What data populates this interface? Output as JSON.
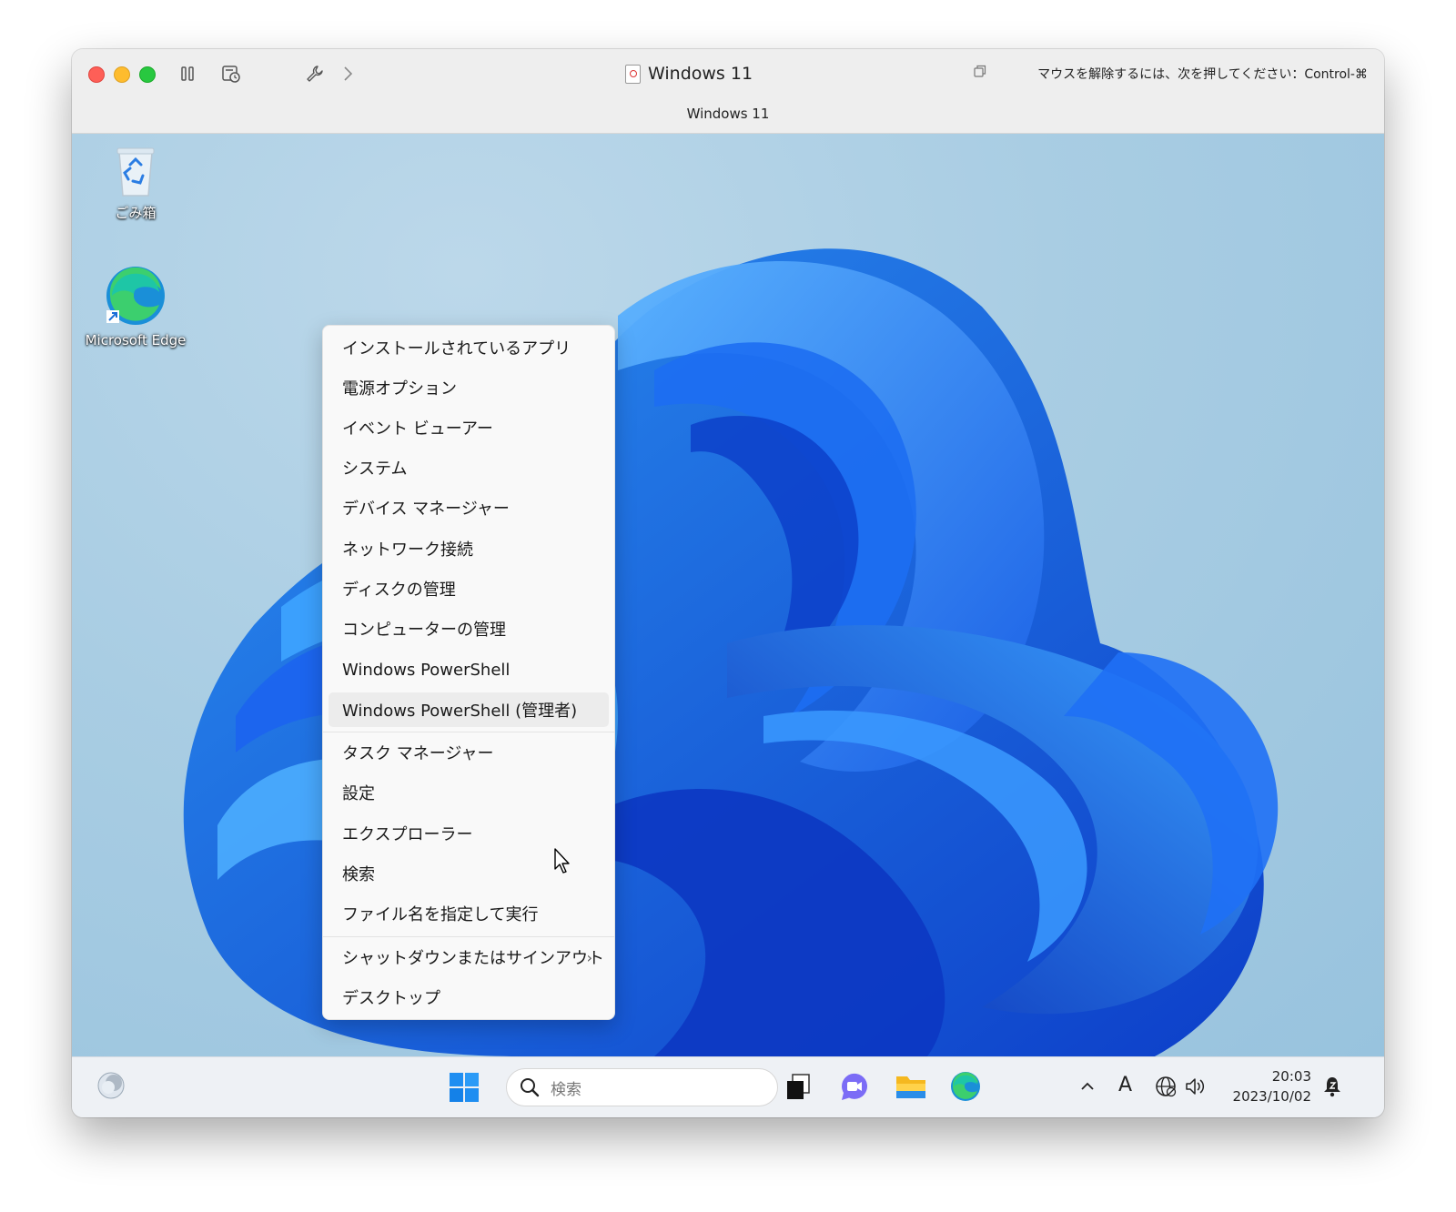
{
  "host_window": {
    "title": "Windows 11",
    "subtitle": "Windows 11",
    "release_hint": "マウスを解除するには、次を押してください：Control-⌘",
    "buttons": [
      "close",
      "minimize",
      "maximize",
      "pause-icon",
      "snapshot-icon",
      "wrench-icon",
      "chevron-right-icon",
      "copy-icon"
    ]
  },
  "desktop": {
    "icons": [
      {
        "label": "ごみ箱",
        "icon": "recycle-bin-icon"
      },
      {
        "label": "Microsoft Edge",
        "icon": "edge-icon"
      }
    ]
  },
  "context_menu": {
    "items": [
      "インストールされているアプリ",
      "電源オプション",
      "イベント ビューアー",
      "システム",
      "デバイス マネージャー",
      "ネットワーク接続",
      "ディスクの管理",
      "コンピューターの管理",
      "Windows PowerShell",
      "Windows PowerShell (管理者)",
      "タスク マネージャー",
      "設定",
      "エクスプローラー",
      "検索",
      "ファイル名を指定して実行",
      "シャットダウンまたはサインアウト",
      "デスクトップ"
    ],
    "hovered": "Windows PowerShell (管理者)",
    "submenu_chevron": "›"
  },
  "taskbar": {
    "search_placeholder": "検索",
    "apps": [
      "start-icon",
      "task-view-icon",
      "chat-icon",
      "file-explorer-icon",
      "edge-icon"
    ],
    "tray": {
      "ime": "A",
      "time": "20:03",
      "date": "2023/10/02"
    }
  }
}
